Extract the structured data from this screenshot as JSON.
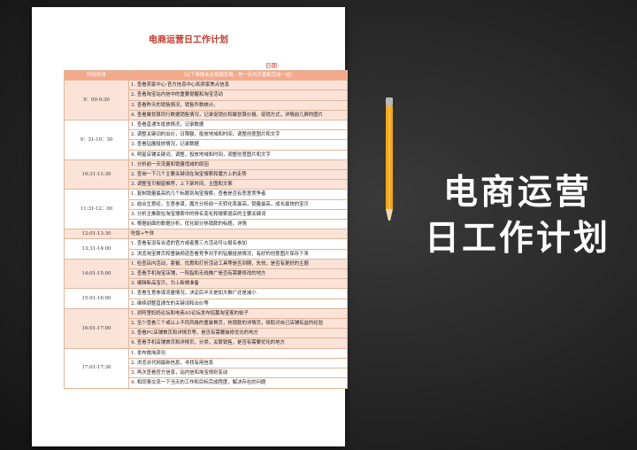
{
  "document": {
    "title": "电商运营日工作计划",
    "date_label": "日期:",
    "header": {
      "time_col": "时间安排",
      "note_col": "（以下事情未必按顺序做，但一天内尽量都完成一边）"
    },
    "groups": [
      {
        "time": "9：00-9:30",
        "tasks": [
          "1. 查看卖家中心-官方信息中心和卖家焦点信息",
          "2. 查看淘宝站内信中的重要提醒和淘宝活动",
          "3. 查看昨天的销售情况，销售件数统计。",
          "4. 查看聚划算同行数据销售情况，记录促销价和聚划算价格，促销方式，详情前几屏的图片"
        ]
      },
      {
        "time": "9：31-10：30",
        "tasks": [
          "1. 查看直通车投放情况，记录数据",
          "2. 调整关键词的出价，日限额，投放地域和时间，调整创意图片和文字",
          "3. 查看钻展投放情况，记录数据",
          "4. 明星店铺关键词，调整，投放地域和时间，调整创意图片和文字"
        ]
      },
      {
        "time": "10:31-11:30",
        "tasks": [
          "1. 分析前一天流量和销量增减的原因",
          "2. 查询一下几个主要关键词在淘宝搜索和魔方上的走势",
          "3. 调整宝贝橱窗推荐，上下架时间，主图和文案"
        ]
      },
      {
        "time": "11:31-12：00",
        "tasks": [
          "1. 复制销量最高的几个标题到淘宝搜索，查看是否有恶意竞争者",
          "2. 结合生意经，生意参谋，魔方分析前一天转化率最高，销量最高，成长最快的宝贝",
          "3. 分析主推款在淘宝搜索中的排名变化和搜索退店的主要关键词",
          "4. 根据前面的数据分析，优化部分热销款的标题，详情"
        ]
      },
      {
        "time": "12:01-13:30",
        "tasks": [
          "吃饭+午休"
        ]
      },
      {
        "time": "13:31-14:00",
        "tasks": [
          "1. 查看有没有合适的官方或者第三方活动可以报名参加",
          "2. 浏览淘宝首页和童装频道查看竞争对手的钻展投放情况，有好的创意图片保存下来"
        ]
      },
      {
        "time": "14:01-15:00",
        "tasks": [
          "1. 检查店内活动，套餐，优惠和打折活动工具等是否到期，失效，是否有更好的主题",
          "2. 查看手机淘宝店铺，一阳指和无线推广是否有需要修改的地方",
          "3. 编辑新品宝贝，为上新做准备"
        ]
      },
      {
        "time": "15:01-16:00",
        "tasks": [
          "1. 查看生意参谋流量情况，决定后半天是加大推广还是减小",
          "2. 继续调整直通车的关键词和出价等"
        ]
      },
      {
        "time": "16:01-17:00",
        "tasks": [
          "1. 到阿里妈妈论坛和电商A5论坛发布招募淘宝客的帖子",
          "2. 至少查看三个或以上不同风格的童装首页，热销款的详情页，吸取对自己店铺有益的经验",
          "3. 查看PC店铺首页和详情页等，是否有需要装修优化的地方",
          "4. 查看手机店铺首页和详情页，分类，关联销售，是否有需要优化的地方"
        ]
      },
      {
        "time": "17:01-17:30",
        "tasks": [
          "1. 发布微淘资讯",
          "2. 浏览派代网最新信息，寻找有用信息",
          "3. 再次查看官方信息，站内信和淘宝规则变动",
          "4. 和同事交流一下当天的工作和目标完成程度，解决存在的问题"
        ]
      }
    ]
  },
  "headline": {
    "line1": "电商运营",
    "line2": "日工作计划"
  },
  "colors": {
    "header_orange": "#f4a98b",
    "row_pink": "#fbe3d8",
    "title_red": "#c0392b"
  },
  "icons": [
    "pencil-icon"
  ]
}
